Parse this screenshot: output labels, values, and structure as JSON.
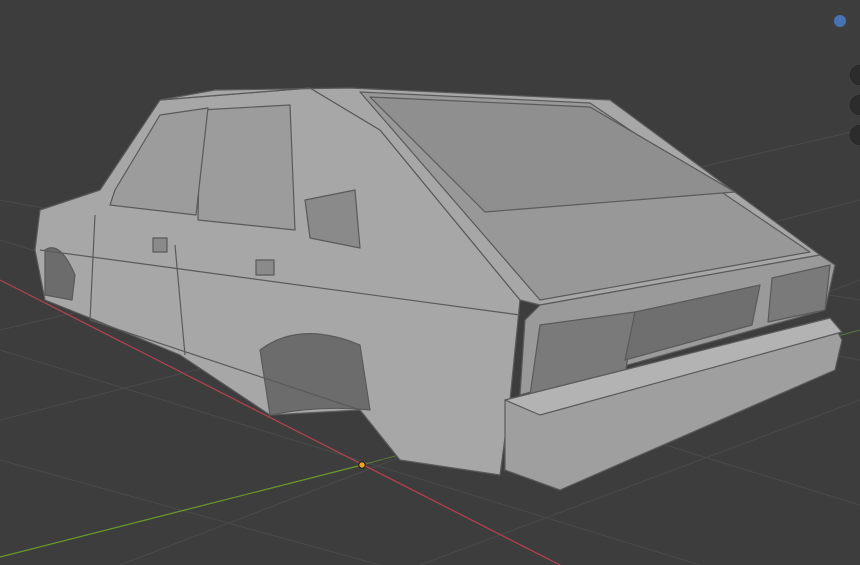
{
  "viewport": {
    "background": "#3d3d3d",
    "grid_color": "#4a4a4a",
    "x_axis_color": "#b5434f",
    "y_axis_color": "#6a9a2b",
    "origin_color": "#f5a11c"
  },
  "model": {
    "body_color": "#a7a7a7",
    "shade_color": "#8e8e8e",
    "dark_color": "#6f6f6f",
    "edge_color": "#5a5a5a"
  },
  "icons": {
    "gizmo_z": "axis-dot-icon",
    "view_buttons": [
      "zoom-icon",
      "pan-icon",
      "camera-icon"
    ]
  }
}
